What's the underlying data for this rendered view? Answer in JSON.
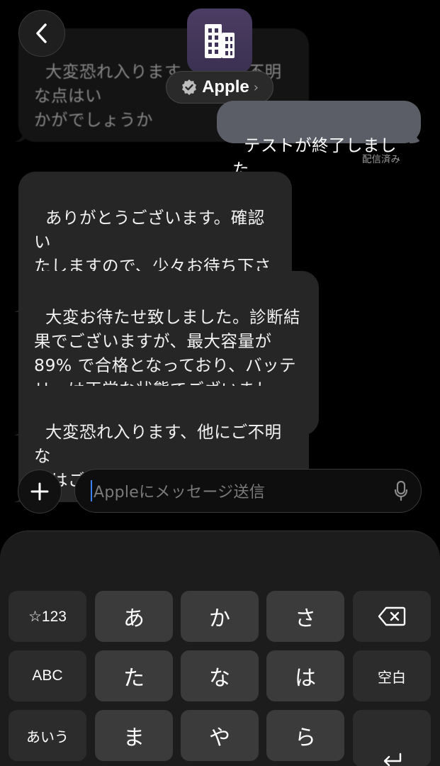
{
  "header": {
    "back_label": "back",
    "contact_name": "Apple",
    "top_ghost_text": "大変恐れ入ります、他にご不明な点はい\nかがでしょうか"
  },
  "messages": [
    {
      "direction": "out",
      "text": "テストが終了しました",
      "status": "配信済み"
    },
    {
      "direction": "in",
      "text": "ありがとうございます。確認い\nたしますので、少々お待ち下さ\nいませ。"
    },
    {
      "direction": "in",
      "text": "大変お待たせ致しました。診断結\n果でございますが、最大容量が\n89% で合格となっており、バッテ\nリーは正常な状態でございました。"
    },
    {
      "direction": "in",
      "text": "大変恐れ入ります、他にご不明な\n点はございませんでしょうか"
    }
  ],
  "composer": {
    "placeholder": "Appleにメッセージ送信"
  },
  "keyboard": {
    "row1": [
      "☆123",
      "あ",
      "か",
      "さ"
    ],
    "row2": [
      "ABC",
      "た",
      "な",
      "は",
      "空白"
    ],
    "row3": [
      "あいう",
      "ま",
      "や",
      "ら"
    ]
  },
  "colors": {
    "incoming_bubble": "#262626",
    "outgoing_bubble": "#5b5e66",
    "caret": "#3b82f6"
  }
}
